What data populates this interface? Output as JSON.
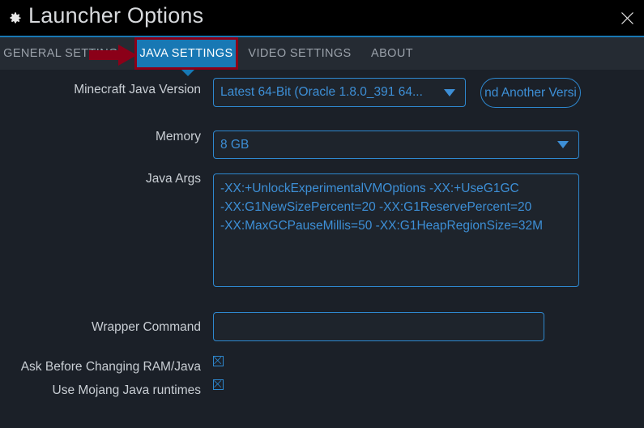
{
  "window": {
    "title": "Launcher Options",
    "gear_icon": "gear-icon",
    "close_icon": "close-icon",
    "accent_color": "#1878b4",
    "titlebar_bg": "#000000"
  },
  "tabs": {
    "items": [
      {
        "label": "GENERAL SETTINGS",
        "active": false
      },
      {
        "label": "JAVA SETTINGS",
        "active": true
      },
      {
        "label": "VIDEO SETTINGS",
        "active": false
      },
      {
        "label": "ABOUT",
        "active": false
      }
    ],
    "active_index": 1,
    "active_bg": "#1878b4",
    "highlight_border_color": "#8b0018",
    "annotation_arrow_color": "#8b0018"
  },
  "form": {
    "java_version": {
      "label": "Minecraft Java Version",
      "value": "Latest 64-Bit (Oracle 1.8.0_391 64...",
      "caret_icon": "chevron-down-icon"
    },
    "add_version_button": {
      "label": "nd Another Versi"
    },
    "memory": {
      "label": "Memory",
      "value": "8 GB",
      "caret_icon": "chevron-down-icon"
    },
    "java_args": {
      "label": "Java Args",
      "value": "-XX:+UnlockExperimentalVMOptions -XX:+UseG1GC\n-XX:G1NewSizePercent=20 -XX:G1ReservePercent=20\n-XX:MaxGCPauseMillis=50 -XX:G1HeapRegionSize=32M",
      "placeholder": ""
    },
    "wrapper_command": {
      "label": "Wrapper Command",
      "value": "",
      "placeholder": ""
    },
    "ask_before_changing": {
      "label": "Ask Before Changing RAM/Java",
      "checked": true
    },
    "use_mojang_runtimes": {
      "label": "Use Mojang Java runtimes",
      "checked": true
    }
  },
  "colors": {
    "page_bg": "#1b2028",
    "tabbar_bg": "#252b33",
    "field_bg": "#1e242c",
    "field_border": "#2e88cf",
    "field_text": "#3d8fd6",
    "label_text": "#c9ced4"
  }
}
